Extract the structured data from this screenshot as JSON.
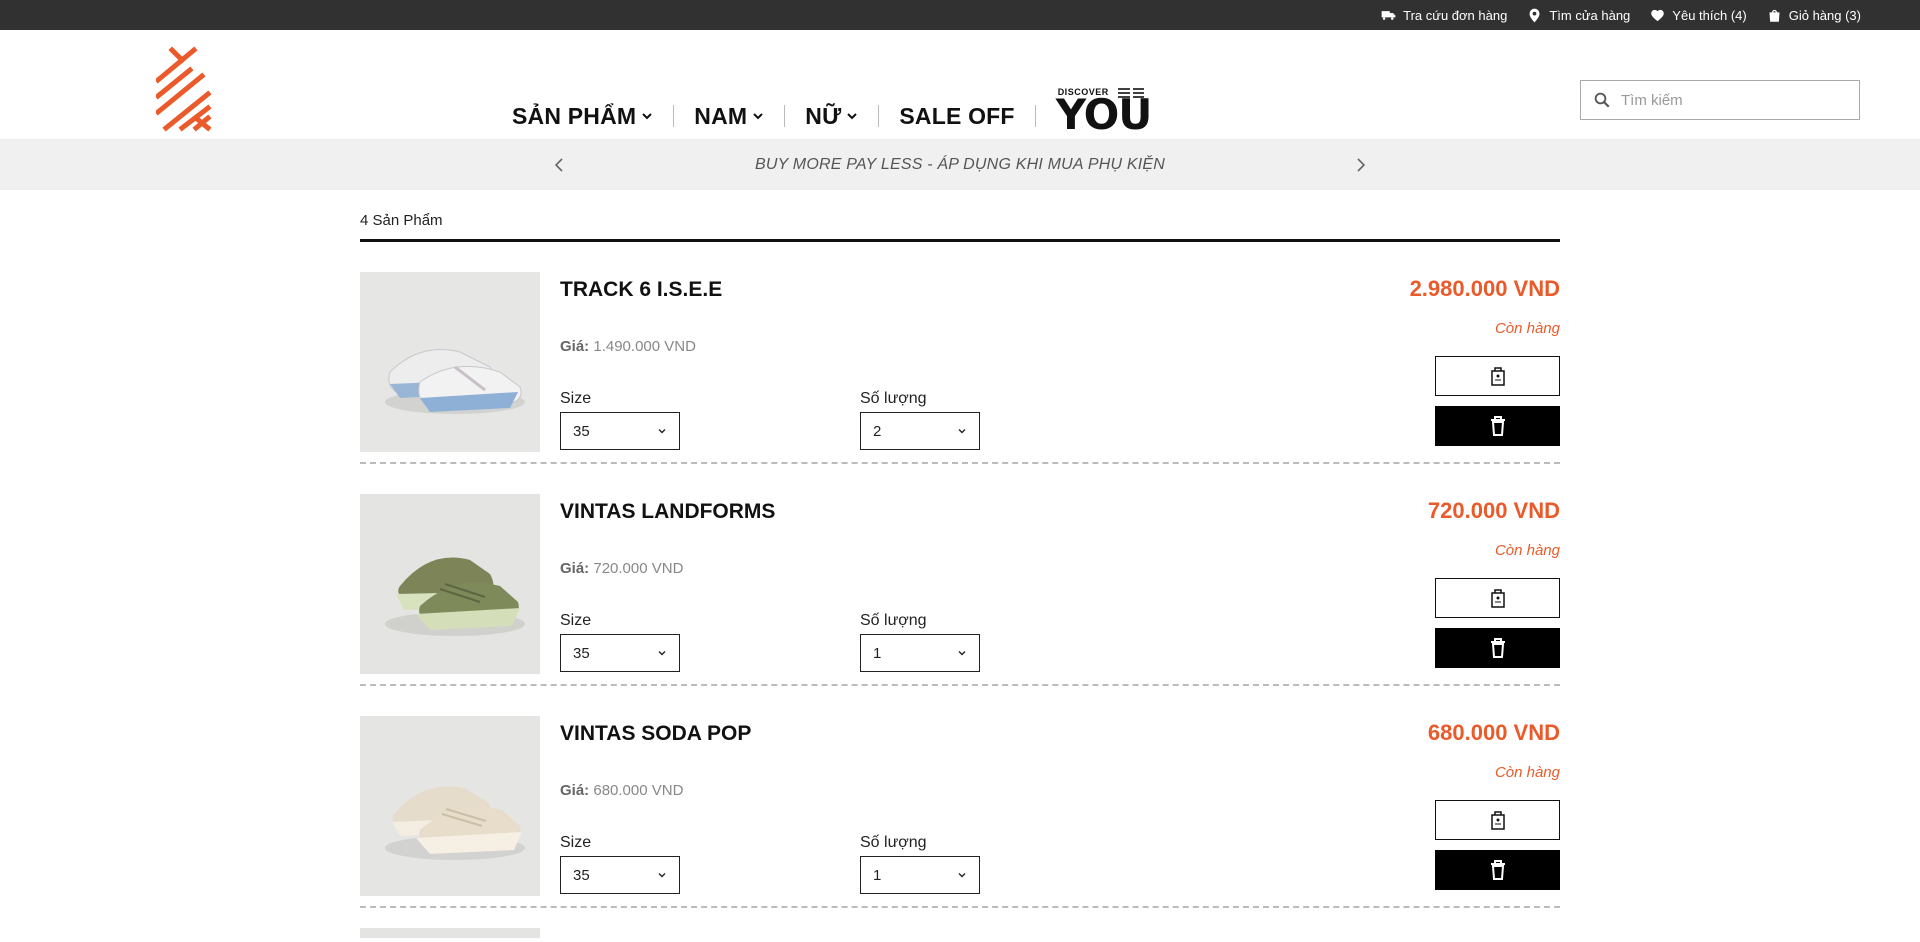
{
  "topbar": {
    "items": [
      {
        "label": "Tra cứu đơn hàng",
        "icon": "truck-icon"
      },
      {
        "label": "Tìm cửa hàng",
        "icon": "location-pin-icon"
      },
      {
        "label": "Yêu thích (4)",
        "icon": "heart-icon"
      },
      {
        "label": "Giỏ hàng (3)",
        "icon": "shopping-bag-icon"
      }
    ]
  },
  "nav": {
    "items": [
      "SẢN PHẨM",
      "NAM",
      "NỮ",
      "SALE OFF"
    ],
    "discover_small": "DISCOVER",
    "discover_big": "YOU"
  },
  "search": {
    "placeholder": "Tìm kiếm"
  },
  "promo": {
    "text": "BUY MORE PAY LESS - ÁP DỤNG KHI MUA PHỤ KIỆN"
  },
  "cart": {
    "count_label": "4 Sản Phẩm",
    "price_prefix": "Giá:",
    "size_label": "Size",
    "qty_label": "Số lượng",
    "items": [
      {
        "name": "TRACK 6 I.S.E.E",
        "unit_price": "1.490.000 VND",
        "size": "35",
        "quantity": "2",
        "total": "2.980.000 VND",
        "stock": "Còn hàng"
      },
      {
        "name": "VINTAS LANDFORMS",
        "unit_price": "720.000 VND",
        "size": "35",
        "quantity": "1",
        "total": "720.000 VND",
        "stock": "Còn hàng"
      },
      {
        "name": "VINTAS SODA POP",
        "unit_price": "680.000 VND",
        "size": "35",
        "quantity": "1",
        "total": "680.000 VND",
        "stock": "Còn hàng"
      }
    ]
  },
  "colors": {
    "accent": "#ea5a2a",
    "topbar": "#313131",
    "promo_bg": "#f0f0f0"
  }
}
